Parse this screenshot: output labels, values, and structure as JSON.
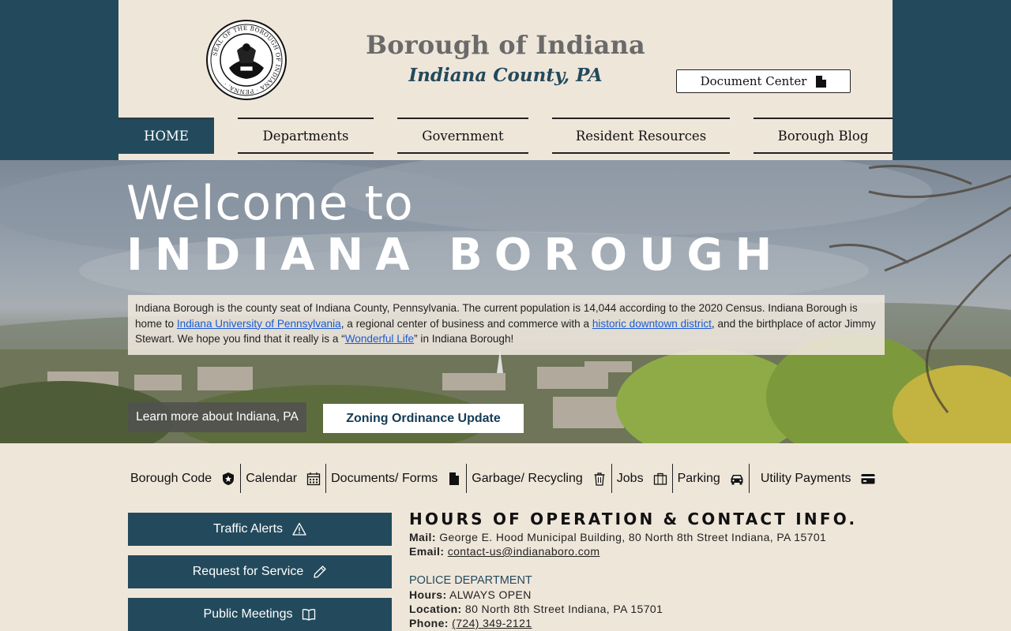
{
  "header": {
    "title": "Borough of Indiana",
    "subtitle": "Indiana County, PA",
    "document_center": "Document Center",
    "seal_text": "SEAL OF THE BOROUGH OF INDIANA PENNA."
  },
  "nav": [
    {
      "label": "HOME",
      "active": true
    },
    {
      "label": "Departments"
    },
    {
      "label": "Government"
    },
    {
      "label": "Resident Resources"
    },
    {
      "label": "Borough Blog"
    }
  ],
  "hero": {
    "welcome": "Welcome to",
    "title": "INDIANA BOROUGH",
    "desc_1": "Indiana Borough is the county seat of Indiana County, Pennsylvania. The current population is 14,044 according to the 2020 Census. Indiana Borough is home to ",
    "link_iup": "Indiana University of Pennsylvania",
    "desc_2": ", a regional center of business and commerce with a ",
    "link_downtown": "historic downtown district",
    "desc_3": ", and the birthplace of actor Jimmy Stewart. We hope you find that it really is a “",
    "link_wonderful": "Wonderful Life",
    "desc_4": "” in Indiana Borough!",
    "learn_more": "Learn more about Indiana, PA",
    "zoning": "Zoning Ordinance Update"
  },
  "quick_links": [
    {
      "label": "Borough Code",
      "icon": "shield-icon"
    },
    {
      "label": "Calendar",
      "icon": "calendar-icon"
    },
    {
      "label": "Documents/ Forms",
      "icon": "document-icon"
    },
    {
      "label": "Garbage/ Recycling",
      "icon": "trash-icon"
    },
    {
      "label": "Jobs",
      "icon": "briefcase-icon"
    },
    {
      "label": "Parking",
      "icon": "car-icon"
    },
    {
      "label": "Utility Payments",
      "icon": "credit-card-icon"
    }
  ],
  "side_buttons": [
    {
      "label": "Traffic Alerts",
      "icon": "warning-icon"
    },
    {
      "label": "Request for Service",
      "icon": "pencil-icon"
    },
    {
      "label": "Public Meetings",
      "icon": "book-icon"
    }
  ],
  "contact": {
    "heading": "HOURS OF OPERATION & CONTACT INFO.",
    "mail_label": "Mail:",
    "mail_value": "George E. Hood Municipal Building, 80 North 8th Street Indiana, PA 15701",
    "email_label": "Email:",
    "email_value": "contact-us@indianaboro.com",
    "police_heading": "POLICE DEPARTMENT",
    "hours_label": "Hours:",
    "hours_value": "ALWAYS OPEN",
    "location_label": "Location:",
    "location_value": "80 North 8th Street Indiana, PA 15701",
    "phone_label": "Phone:",
    "phone_value": "(724) 349-2121"
  },
  "colors": {
    "brand": "#234a5c",
    "background": "#efe6da",
    "link": "#1a5ad6"
  }
}
